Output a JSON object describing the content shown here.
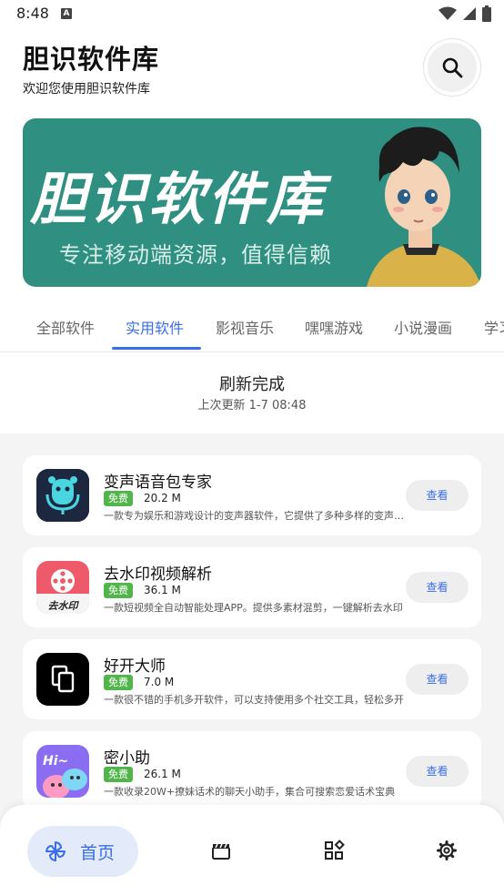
{
  "status": {
    "time": "8:48",
    "a_badge": "A"
  },
  "header": {
    "title": "胆识软件库",
    "subtitle": "欢迎您使用胆识软件库"
  },
  "banner": {
    "title": "胆识软件库",
    "slogan": "专注移动端资源，值得信赖"
  },
  "tabs": [
    {
      "label": "全部软件"
    },
    {
      "label": "实用软件"
    },
    {
      "label": "影视音乐"
    },
    {
      "label": "嘿嘿游戏"
    },
    {
      "label": "小说漫画"
    },
    {
      "label": "学习"
    }
  ],
  "refresh": {
    "title": "刷新完成",
    "subtitle": "上次更新 1-7 08:48"
  },
  "apps": [
    {
      "name": "变声语音包专家",
      "badge": "免费",
      "size": "20.2 M",
      "desc": "一款专为娱乐和游戏设计的变声器软件，它提供了多种多样的变声效果",
      "button": "查看",
      "icon": "voice-changer-icon"
    },
    {
      "name": "去水印视频解析",
      "badge": "免费",
      "size": "36.1 M",
      "desc": "一款短视频全自动智能处理APP。提供多素材混剪，一键解析去水印",
      "button": "查看",
      "icon": "watermark-remover-icon",
      "icon_text": "去水印"
    },
    {
      "name": "好开大师",
      "badge": "免费",
      "size": "7.0 M",
      "desc": "一款很不错的手机多开软件，可以支持使用多个社交工具，轻松多开",
      "button": "查看",
      "icon": "multi-open-icon"
    },
    {
      "name": "密小助",
      "badge": "免费",
      "size": "26.1 M",
      "desc": "一款收录20W+撩妹话术的聊天小助手，集合可搜索恋爱话术宝典",
      "button": "查看",
      "icon": "chat-helper-icon",
      "icon_text": "Hi~"
    }
  ],
  "bottom_nav": {
    "home_label": "首页"
  },
  "colors": {
    "accent": "#3a6ee8",
    "banner_bg": "#2f8f80",
    "free_badge": "#52b54b"
  }
}
